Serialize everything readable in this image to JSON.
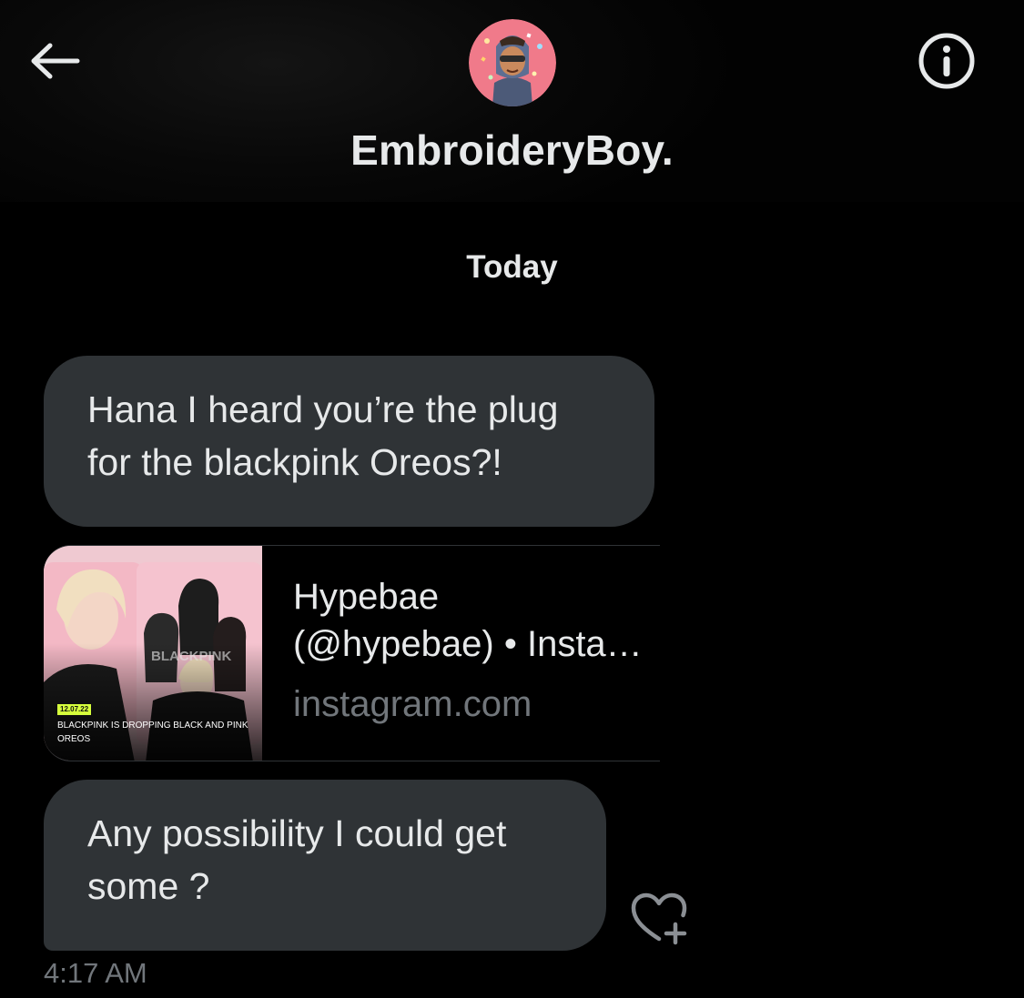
{
  "header": {
    "back_icon": "arrow-left-icon",
    "title": "EmbroideryBoy.",
    "info_icon": "info-circle-icon"
  },
  "conversation": {
    "date_divider": "Today",
    "messages": [
      {
        "type": "text",
        "text": "Hana I heard you’re the plug for the blackpink Oreos?!"
      },
      {
        "type": "link",
        "title_line1": "Hypebae",
        "title_line2": "(@hypebae) • Instagram photos and videos",
        "domain": "instagram.com",
        "thumbnail": {
          "date_tag": "12.07.22",
          "caption": "BLACKPINK IS DROPPING BLACK AND PINK OREOS"
        }
      },
      {
        "type": "text",
        "text": "Any possibility I could get some ?"
      }
    ],
    "like_icon": "heart-plus-icon",
    "timestamp": "4:17 AM"
  },
  "colors": {
    "background": "#000000",
    "bubble": "#2f3336",
    "text_primary": "#e7e9ea",
    "text_secondary": "#71767b"
  }
}
